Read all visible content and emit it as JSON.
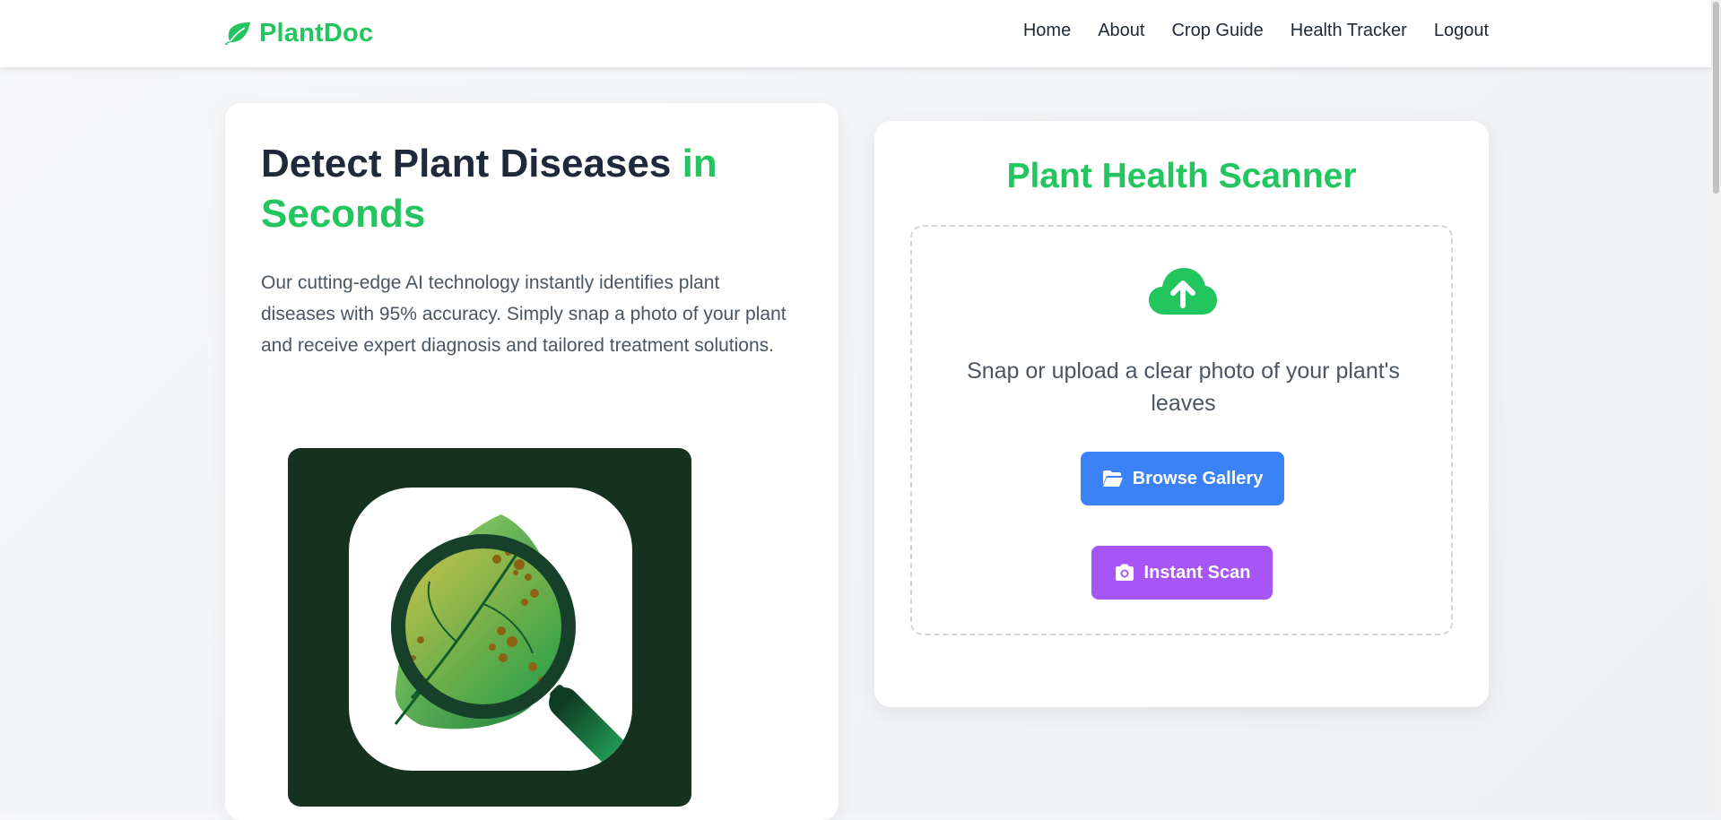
{
  "brand": {
    "name": "PlantDoc",
    "color": "#22c55e",
    "logo_icon": "leaf-icon"
  },
  "nav": {
    "items": [
      "Home",
      "About",
      "Crop Guide",
      "Health Tracker",
      "Logout"
    ]
  },
  "hero": {
    "title_main": "Detect Plant Diseases ",
    "title_accent": "in Seconds",
    "description": "Our cutting-edge AI technology instantly identifies plant diseases with 95% accuracy. Simply snap a photo of your plant and receive expert diagnosis and tailored treatment solutions.",
    "image_icon": "magnifier-leaf-icon"
  },
  "scanner": {
    "title": "Plant Health Scanner",
    "upload_icon": "cloud-upload-icon",
    "prompt": "Snap or upload a clear photo of your plant's leaves",
    "browse_label": "Browse Gallery",
    "browse_icon": "folder-open-icon",
    "browse_color": "#3b82f6",
    "scan_label": "Instant Scan",
    "scan_icon": "camera-icon",
    "scan_color": "#a855f7"
  }
}
